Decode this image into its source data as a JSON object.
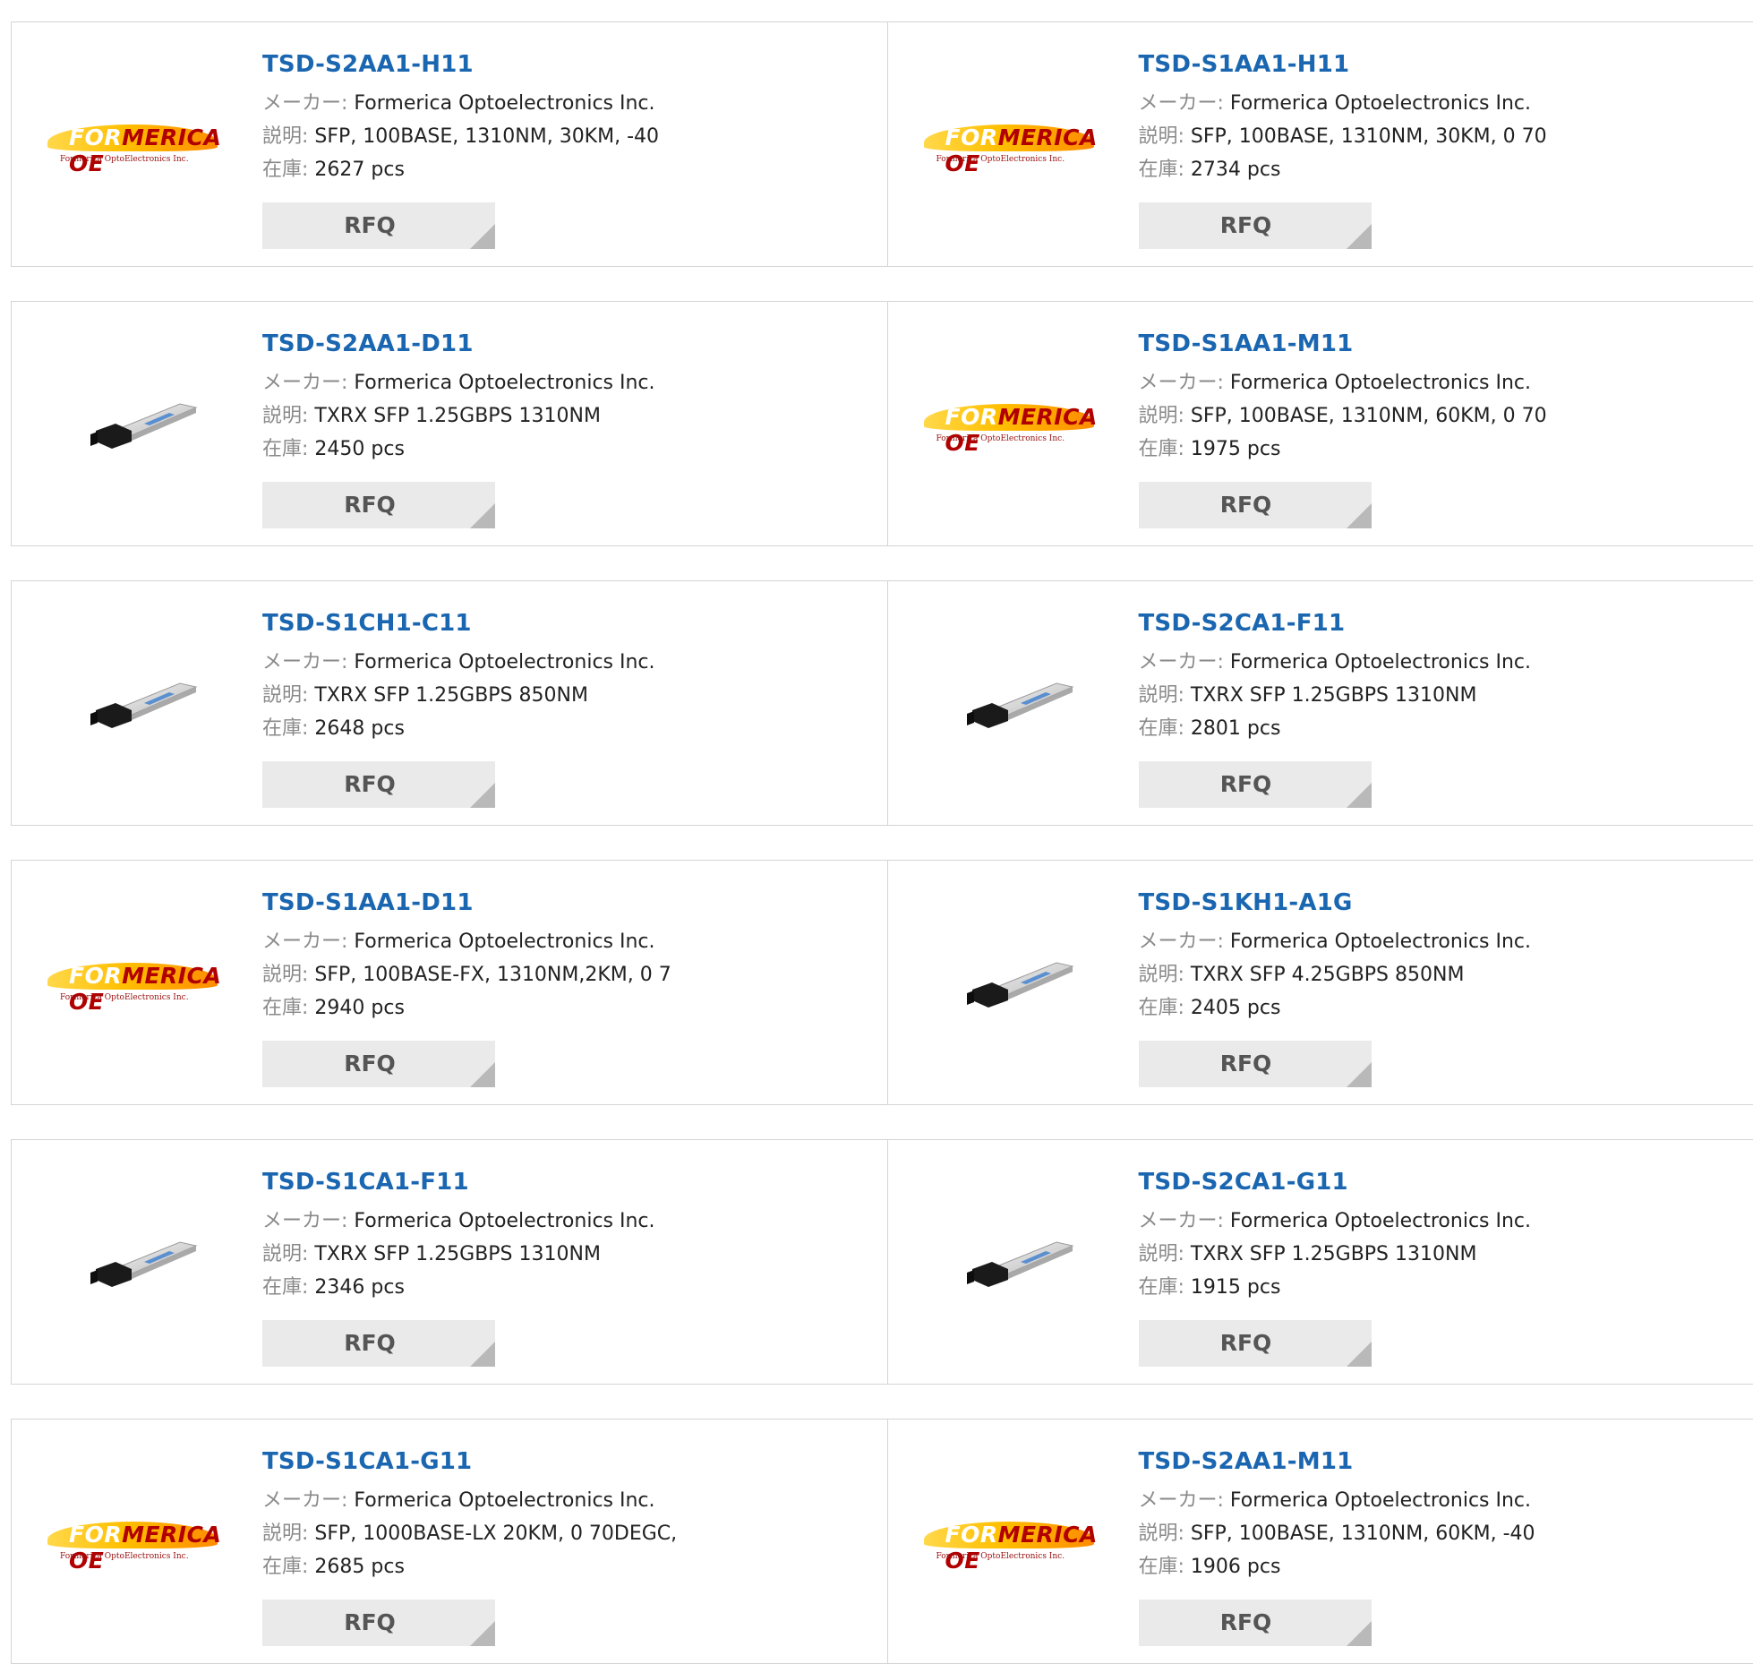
{
  "labels": {
    "maker": "メーカー:",
    "description": "説明:",
    "stock": "在庫:",
    "rfq": "RFQ"
  },
  "logo": {
    "brand_prefix": "FOR",
    "brand_rest": "MERICA OE",
    "subtitle": "Formerica OptoElectronics Inc."
  },
  "products": [
    {
      "pn": "TSD-S2AA1-H11",
      "maker": "Formerica Optoelectronics Inc.",
      "desc": "SFP, 100BASE, 1310NM, 30KM, -40",
      "stock": "2627 pcs",
      "image": "formerica-logo"
    },
    {
      "pn": "TSD-S1AA1-H11",
      "maker": "Formerica Optoelectronics Inc.",
      "desc": "SFP, 100BASE, 1310NM, 30KM, 0 70",
      "stock": "2734 pcs",
      "image": "formerica-logo"
    },
    {
      "pn": "TSD-S2AA1-D11",
      "maker": "Formerica Optoelectronics Inc.",
      "desc": "TXRX SFP 1.25GBPS 1310NM",
      "stock": "2450 pcs",
      "image": "sfp-module"
    },
    {
      "pn": "TSD-S1AA1-M11",
      "maker": "Formerica Optoelectronics Inc.",
      "desc": "SFP, 100BASE, 1310NM, 60KM, 0 70",
      "stock": "1975 pcs",
      "image": "formerica-logo"
    },
    {
      "pn": "TSD-S1CH1-C11",
      "maker": "Formerica Optoelectronics Inc.",
      "desc": "TXRX SFP 1.25GBPS 850NM",
      "stock": "2648 pcs",
      "image": "sfp-module"
    },
    {
      "pn": "TSD-S2CA1-F11",
      "maker": "Formerica Optoelectronics Inc.",
      "desc": "TXRX SFP 1.25GBPS 1310NM",
      "stock": "2801 pcs",
      "image": "sfp-module"
    },
    {
      "pn": "TSD-S1AA1-D11",
      "maker": "Formerica Optoelectronics Inc.",
      "desc": "SFP, 100BASE-FX, 1310NM,2KM, 0 7",
      "stock": "2940 pcs",
      "image": "formerica-logo"
    },
    {
      "pn": "TSD-S1KH1-A1G",
      "maker": "Formerica Optoelectronics Inc.",
      "desc": "TXRX SFP 4.25GBPS 850NM",
      "stock": "2405 pcs",
      "image": "sfp-module"
    },
    {
      "pn": "TSD-S1CA1-F11",
      "maker": "Formerica Optoelectronics Inc.",
      "desc": "TXRX SFP 1.25GBPS 1310NM",
      "stock": "2346 pcs",
      "image": "sfp-module"
    },
    {
      "pn": "TSD-S2CA1-G11",
      "maker": "Formerica Optoelectronics Inc.",
      "desc": "TXRX SFP 1.25GBPS 1310NM",
      "stock": "1915 pcs",
      "image": "sfp-module"
    },
    {
      "pn": "TSD-S1CA1-G11",
      "maker": "Formerica Optoelectronics Inc.",
      "desc": "SFP, 1000BASE-LX 20KM, 0 70DEGC,",
      "stock": "2685 pcs",
      "image": "formerica-logo"
    },
    {
      "pn": "TSD-S2AA1-M11",
      "maker": "Formerica Optoelectronics Inc.",
      "desc": "SFP, 100BASE, 1310NM, 60KM, -40",
      "stock": "1906 pcs",
      "image": "formerica-logo"
    }
  ],
  "colors": {
    "part_number": "#1a66b0",
    "border": "#d4d4d4",
    "rfq_bg": "#eaeaea"
  }
}
